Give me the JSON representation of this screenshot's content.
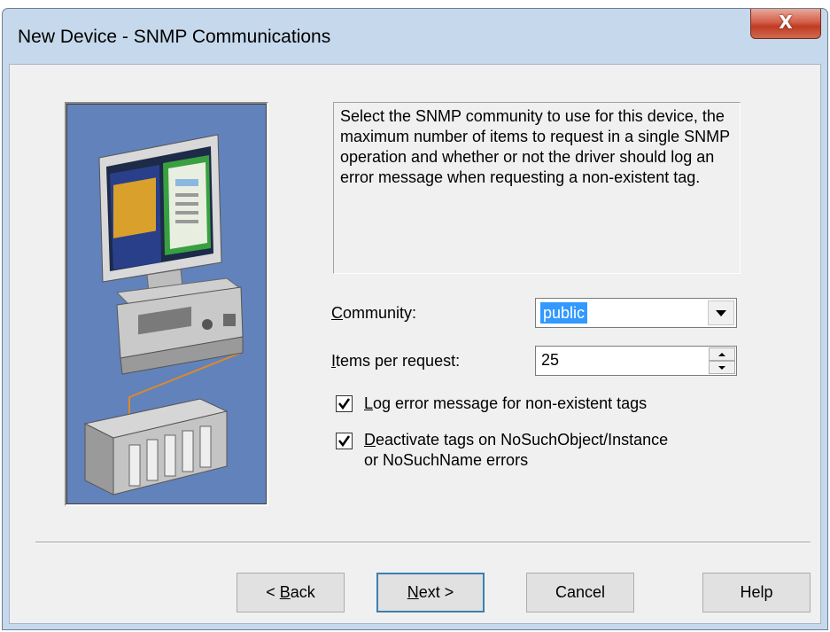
{
  "window": {
    "title": "New Device - SNMP Communications",
    "close_glyph": "X"
  },
  "description": "Select the SNMP community to use for this device, the maximum number of items to request in a single SNMP operation and whether or not the driver should log an error message when requesting a non-existent tag.",
  "community": {
    "mnemonic": "C",
    "label_rest": "ommunity:",
    "value": "public"
  },
  "items_per_request": {
    "mnemonic": "I",
    "label_rest": "tems per request:",
    "value": "25"
  },
  "log_error": {
    "checked": true,
    "mnemonic": "L",
    "label_rest": "og error message for non-existent tags"
  },
  "deactivate_tags": {
    "checked": true,
    "mnemonic": "D",
    "label_rest_line1": "eactivate tags on NoSuchObject/Instance",
    "label_line2": "or NoSuchName errors"
  },
  "buttons": {
    "back_prefix": "< ",
    "back_mnemonic": "B",
    "back_rest": "ack",
    "next_mnemonic": "N",
    "next_rest": "ext >",
    "cancel": "Cancel",
    "help": "Help"
  },
  "colors": {
    "titlebar": "#c6d8ec",
    "client": "#f0f0f0",
    "illustration_bg": "#6080b8",
    "selection": "#3399ff",
    "close_button": "#c74a33",
    "default_button_border": "#3c7fb1"
  },
  "icons": [
    "close-icon",
    "dropdown-arrow-icon",
    "spin-up-icon",
    "spin-down-icon",
    "checkmark-icon",
    "computer-plc-illustration"
  ]
}
